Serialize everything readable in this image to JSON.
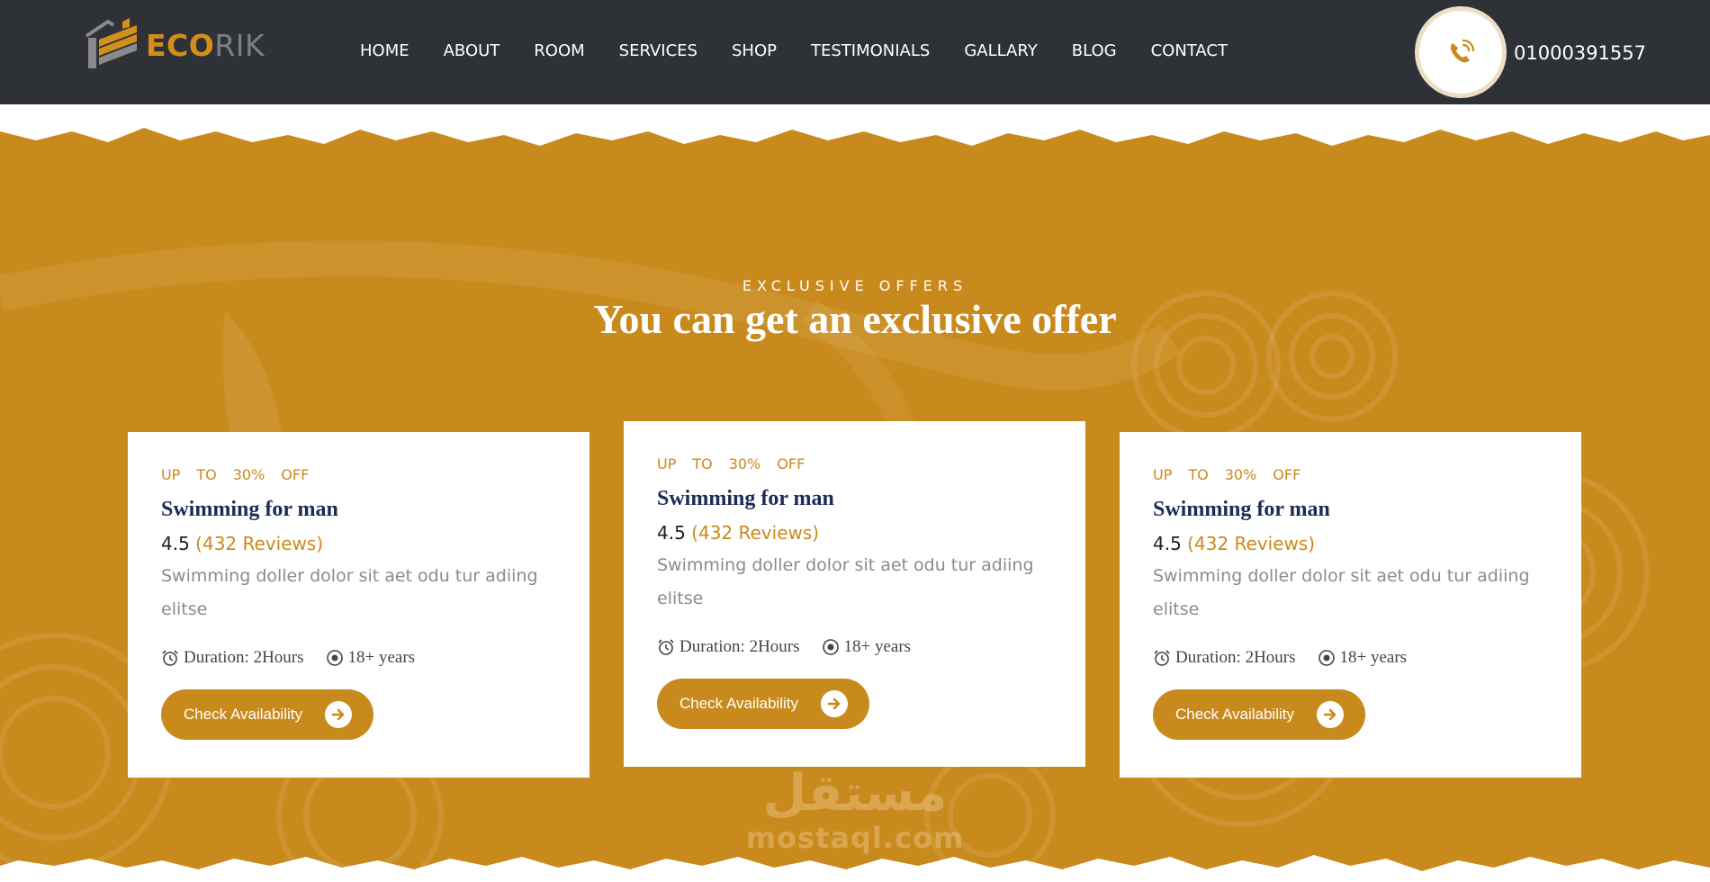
{
  "header": {
    "logo": {
      "part1": "ECO",
      "part2": "RIK"
    },
    "nav": [
      "HOME",
      "ABOUT",
      "ROOM",
      "SERVICES",
      "SHOP",
      "TESTIMONIALS",
      "GALLARY",
      "BLOG",
      "CONTACT"
    ],
    "phone": {
      "icon": "phone-ring-icon",
      "number": "01000391557"
    }
  },
  "section": {
    "kicker": "EXCLUSIVE OFFERS",
    "headline": "You can get an exclusive offer"
  },
  "cards": [
    {
      "offer": [
        "UP",
        "TO",
        "30%",
        "OFF"
      ],
      "title": "Swimming for man",
      "rating": "4.5",
      "reviews": "(432 Reviews)",
      "description": "Swimming doller dolor sit aet odu tur adiing elitse",
      "duration": "Duration: 2Hours",
      "age": "18+ years",
      "button": "Check Availability"
    },
    {
      "offer": [
        "UP",
        "TO",
        "30%",
        "OFF"
      ],
      "title": "Swimming for man",
      "rating": "4.5",
      "reviews": "(432 Reviews)",
      "description": "Swimming doller dolor sit aet odu tur adiing elitse",
      "duration": "Duration: 2Hours",
      "age": "18+ years",
      "button": "Check Availability"
    },
    {
      "offer": [
        "UP",
        "TO",
        "30%",
        "OFF"
      ],
      "title": "Swimming for man",
      "rating": "4.5",
      "reviews": "(432 Reviews)",
      "description": "Swimming doller dolor sit aet odu tur adiing elitse",
      "duration": "Duration: 2Hours",
      "age": "18+ years",
      "button": "Check Availability"
    }
  ],
  "watermark": {
    "arabic": "مستقل",
    "latin": "mostaql.com"
  },
  "colors": {
    "accent": "#c98a1d",
    "header_bg": "#2e3236",
    "title": "#1b2a56"
  }
}
